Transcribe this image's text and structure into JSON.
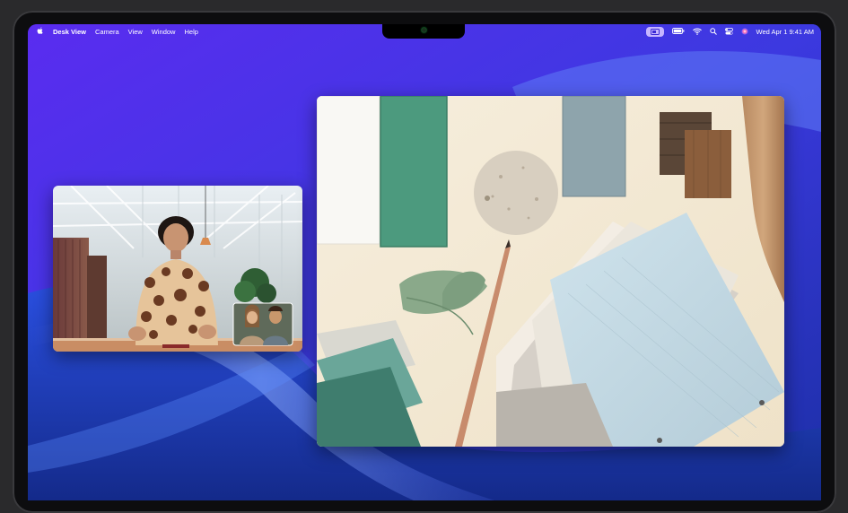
{
  "menubar": {
    "apple": "",
    "app_name": "Desk View",
    "menus": [
      "Camera",
      "View",
      "Window",
      "Help"
    ],
    "clock": "Wed Apr 1  9:41 AM"
  },
  "status_icons": [
    "screen-mirroring-icon",
    "battery-icon",
    "wifi-icon",
    "search-icon",
    "control-center-icon",
    "siri-icon"
  ],
  "windows": {
    "facetime": "facetime-video-window",
    "desk_view": "desk-view-window"
  },
  "colors": {
    "wallpaper_start": "#4d1fd8",
    "wallpaper_end": "#1a2d98",
    "menubar_pill": "#c6b6ff"
  }
}
